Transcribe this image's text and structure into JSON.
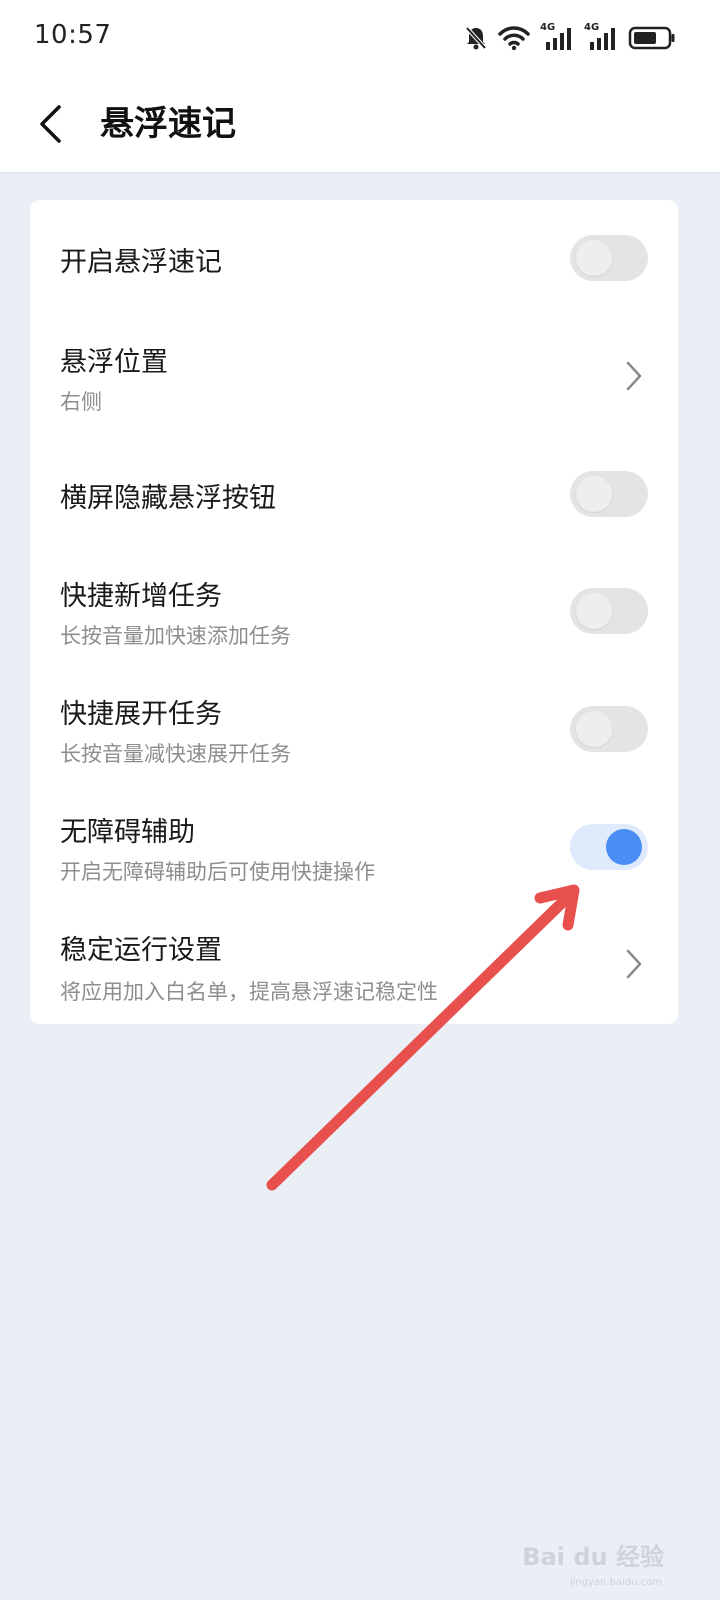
{
  "status_bar": {
    "time": "10:57",
    "network_1": "4G",
    "network_2": "4G",
    "icons": [
      "bell-muted-icon",
      "wifi-icon",
      "signal-icon",
      "signal-icon",
      "battery-icon"
    ]
  },
  "header": {
    "back_icon": "chevron-left-icon",
    "title": "悬浮速记"
  },
  "settings": [
    {
      "title": "开启悬浮速记",
      "subtitle": "",
      "control": "toggle",
      "on": false
    },
    {
      "title": "悬浮位置",
      "subtitle": "右侧",
      "control": "chevron"
    },
    {
      "title": "横屏隐藏悬浮按钮",
      "subtitle": "",
      "control": "toggle",
      "on": false
    },
    {
      "title": "快捷新增任务",
      "subtitle": "长按音量加快速添加任务",
      "control": "toggle",
      "on": false
    },
    {
      "title": "快捷展开任务",
      "subtitle": "长按音量减快速展开任务",
      "control": "toggle",
      "on": false
    },
    {
      "title": "无障碍辅助",
      "subtitle": "开启无障碍辅助后可使用快捷操作",
      "control": "toggle",
      "on": true
    },
    {
      "title": "稳定运行设置",
      "subtitle": "将应用加入白名单，提高悬浮速记稳定性",
      "control": "chevron"
    }
  ],
  "colors": {
    "accent": "#4a8df3",
    "toggle_on_track": "#dfeafc",
    "annotation_arrow": "#e8504e",
    "background": "#eaeef5"
  },
  "watermark": {
    "text": "Bai du 经验",
    "sub": "jingyan.baidu.com"
  }
}
